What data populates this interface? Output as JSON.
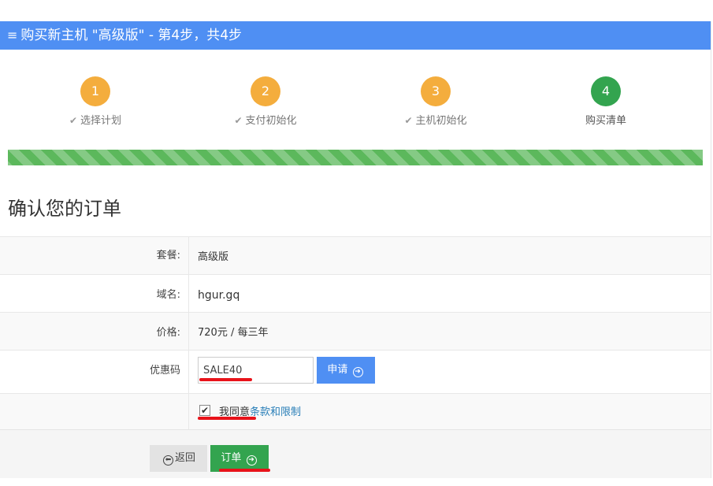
{
  "header": {
    "title": "购买新主机 \"高级版\" - 第4步，共4步",
    "icon": "menu-icon"
  },
  "steps": [
    {
      "number": "1",
      "label": "选择计划",
      "done": true
    },
    {
      "number": "2",
      "label": "支付初始化",
      "done": true
    },
    {
      "number": "3",
      "label": "主机初始化",
      "done": true
    },
    {
      "number": "4",
      "label": "购买清单",
      "done": false,
      "current": true
    }
  ],
  "progress": {
    "percent": 100
  },
  "page_title": "确认您的订单",
  "order": {
    "plan_label": "套餐:",
    "plan_value": "高级版",
    "domain_label": "域名:",
    "domain_value": "hgur.gq",
    "price_label": "价格:",
    "price_value": "720元 / 每三年",
    "coupon_label": "优惠码",
    "coupon_value": "SALE40",
    "apply_label": "申请",
    "agree_prefix": "我同意",
    "agree_link": "条款和限制",
    "agree_checked": true
  },
  "buttons": {
    "back_label": "返回",
    "order_label": "订单"
  },
  "colors": {
    "header": "#4f8ff3",
    "step_done": "#f4ad3d",
    "step_current": "#33a44f",
    "progress": "#5cb85c",
    "order_button": "#33a44f",
    "annotation": "#e8131a"
  }
}
